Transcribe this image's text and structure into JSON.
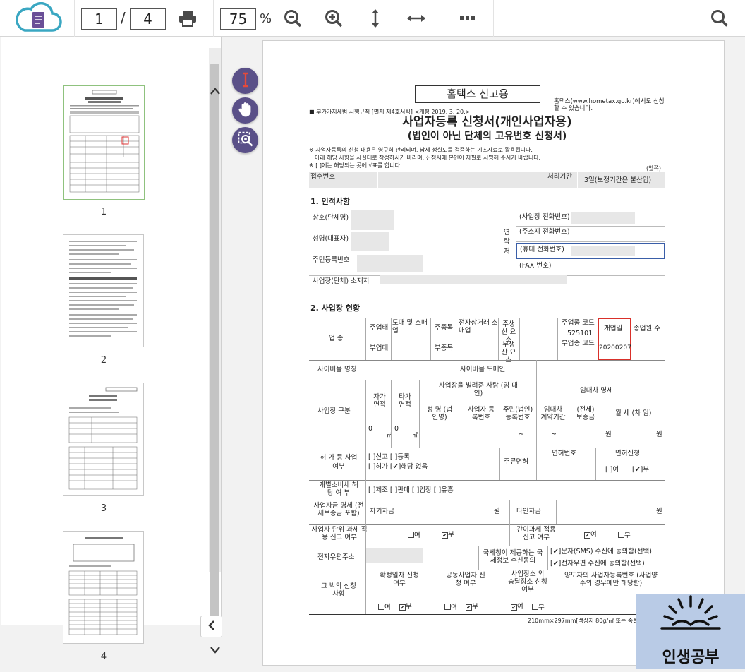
{
  "toolbar": {
    "page_current": "1",
    "page_separator": "/",
    "page_total": "4",
    "zoom": "75",
    "zoom_unit": "%"
  },
  "icons": [
    "cloud-doc-icon",
    "print-icon",
    "zoom-out-icon",
    "zoom-in-icon",
    "fit-height-icon",
    "fit-width-icon",
    "more-icon",
    "search-icon",
    "grid-icon",
    "text-select-icon",
    "hand-icon",
    "zoom-area-icon",
    "chevron-left-icon",
    "chevron-up-icon",
    "chevron-down-icon"
  ],
  "accent": "#5a5088",
  "thumbnails": [
    {
      "label": "1"
    },
    {
      "label": "2"
    },
    {
      "label": "3"
    },
    {
      "label": "4"
    }
  ],
  "form": {
    "banner": "홈택스 신고용",
    "banner_note": "홈택스(www.hometax.go.kr)에서도 신청할 수 있습니다.",
    "law_ref": "■ 부가가치세법 시행규칙 [별지 제4호서식] <개정 2019. 3. 20.>",
    "title1": "사업자등록 신청서(개인사업자용)",
    "title2": "(법인이 아닌 단체의 고유번호 신청서)",
    "notes": [
      "※ 사업자등록의 신청 내용은 영구히 관리되며, 납세 성실도를 검증하는 기초자료로 활용됩니다.",
      "아래 해당 사항을 사실대로 작성하시기 바라며, 신청서에 본인이 자필로 서명해 주시기 바랍니다.",
      "※ [ ]에는 해당되는 곳에 √표를 합니다."
    ],
    "side_note": "(앞쪽)",
    "receipt": {
      "no_label": "접수번호",
      "period_label": "처리기간",
      "period_value": "3일(보정기간은 불산입)"
    },
    "s1": {
      "title": "1. 인적사항",
      "trade_name": "상호(단체명)",
      "name": "성명(대표자)",
      "rrn": "주민등록번호",
      "address": "사업장(단체) 소재지",
      "contact_label": "연 락 처",
      "biz_phone": "(사업장 전화번호)",
      "home_phone": "(주소지 전화번호)",
      "mobile": "(휴대 전화번호)",
      "fax": "(FAX 번호)"
    },
    "s2": {
      "title": "2. 사업장 현황",
      "industry": "업 종",
      "main_type": "주업태",
      "main_type_val": "도매 및 소매업",
      "main_item": "주종목",
      "main_item_val": "전자상거래 소매업",
      "main_prod": "주생산 요소",
      "main_code": "주업종 코드",
      "main_code_val": "525101",
      "open_date": "개업일",
      "open_date_val": "20200207",
      "employees": "종업원 수",
      "sub_type": "부업태",
      "sub_item": "부종목",
      "sub_prod": "부생산 요소",
      "sub_code": "부업종 코드",
      "cyber_name": "사이버몰 명칭",
      "cyber_domain": "사이버몰 도메인",
      "site_type": "사업장 구분",
      "own_area": "자가 면적",
      "rent_area": "타가 면적",
      "lessor": "사업장을 빌려준 사람 (임 대 인)",
      "lease": "임대차 명세",
      "lessor_name": "성 명 (법인명)",
      "lessor_biz": "사업자 등록번호",
      "lessor_rrn": "주민(법인) 등록번호",
      "lease_period": "임대차 계약기간",
      "deposit": "(전세) 보증금",
      "monthly": "월 세 (차 임)",
      "area_val": "0",
      "area_unit": "㎡",
      "tilde": "~",
      "won": "원",
      "permit": "허 가 등 사업 여부",
      "permit_opts1": "[ ]신고  [ ]등록",
      "permit_opts2": "[ ]허가  [✔]해당 없음",
      "liquor": "주류면허",
      "liquor_no": "면허번호",
      "liquor_apply": "면허신청",
      "liquor_yes": "[ ]여",
      "liquor_no_opt": "[✔]부",
      "excise": "개별소비세 해 당 여 부",
      "excise_opts": "[ ]제조  [ ]판매  [ ]입장  [ ]유흥",
      "funds": "사업자금 명세 (전세보증금 포함)",
      "own_funds": "자기자금",
      "borrowed": "타인자금",
      "unit_tax": "사업자 단위 과세 적용 신고 여부",
      "simple_tax": "간이과세 적용 신고 여부",
      "yes": "여",
      "no": "부",
      "email": "전자우편주소",
      "consent_label": "국세청이 제공하는 국세정보 수신동의",
      "consent_sms": "[✔]문자(SMS) 수신에 동의함(선택)",
      "consent_email": "[✔]전자우편 수신에 동의함(선택)",
      "other": "그 밖의 신청사항",
      "fixed_date": "확정일자 신청 여부",
      "joint": "공동사업자 신청 여부",
      "mail": "사업장소 외 송달장소 신청 여부",
      "transferor": "양도자의 사업자등록번호 (사업양수의 경우에만 해당함)",
      "paper_note": "210mm×297mm[백상지 80g/㎡ 또는 중질지 80g/㎡]"
    }
  },
  "brand": {
    "name": "인생공부",
    "bg": "#b9cbe6"
  }
}
